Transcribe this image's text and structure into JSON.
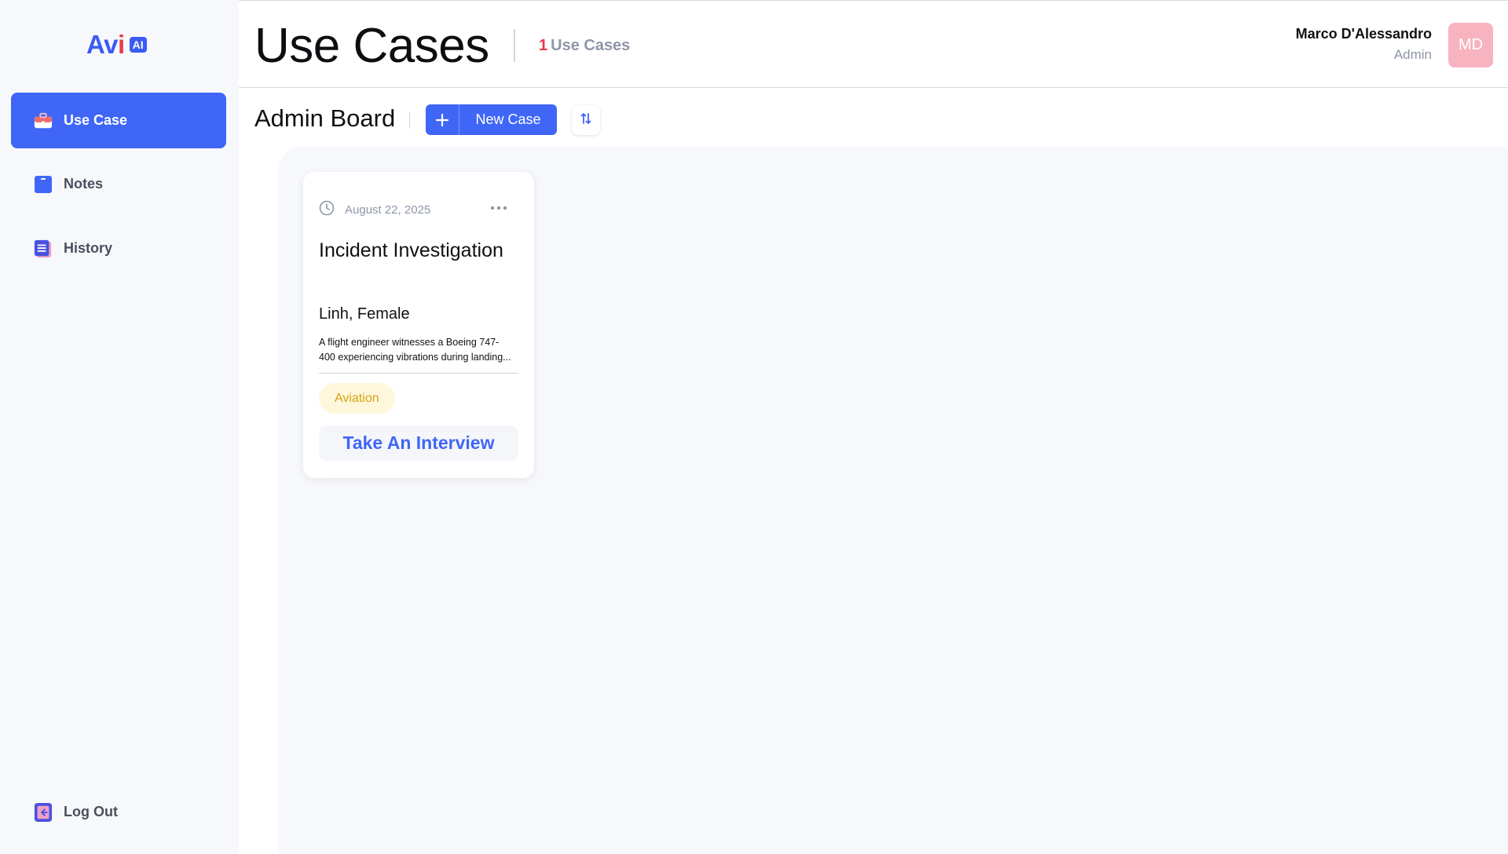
{
  "app": {
    "logo_text": "Av",
    "logo_text_dot": "i",
    "logo_badge": "AI"
  },
  "sidebar": {
    "items": [
      {
        "label": "Use Case",
        "icon": "briefcase-icon",
        "active": true
      },
      {
        "label": "Notes",
        "icon": "note-icon",
        "active": false
      },
      {
        "label": "History",
        "icon": "history-list-icon",
        "active": false
      }
    ],
    "logout_label": "Log Out"
  },
  "header": {
    "title": "Use Cases",
    "count": "1",
    "count_label": "Use Cases",
    "user_name": "Marco D'Alessandro",
    "user_role": "Admin",
    "avatar_initials": "MD"
  },
  "toolbar": {
    "board_title": "Admin Board",
    "new_case_label": "New Case"
  },
  "cards": [
    {
      "date": "August 22, 2025",
      "title": "Incident Investigation",
      "person": "Linh, Female",
      "description_line1": "A flight engineer witnesses a Boeing 747-",
      "description_line2": "400 experiencing vibrations during landing...",
      "tag": "Aviation",
      "action_label": "Take An Interview"
    }
  ],
  "colors": {
    "accent": "#3f66f7",
    "danger": "#e63b4b",
    "tag_bg": "#fff7dc",
    "tag_text": "#d4a413",
    "avatar_bg": "#f8b3c0"
  }
}
